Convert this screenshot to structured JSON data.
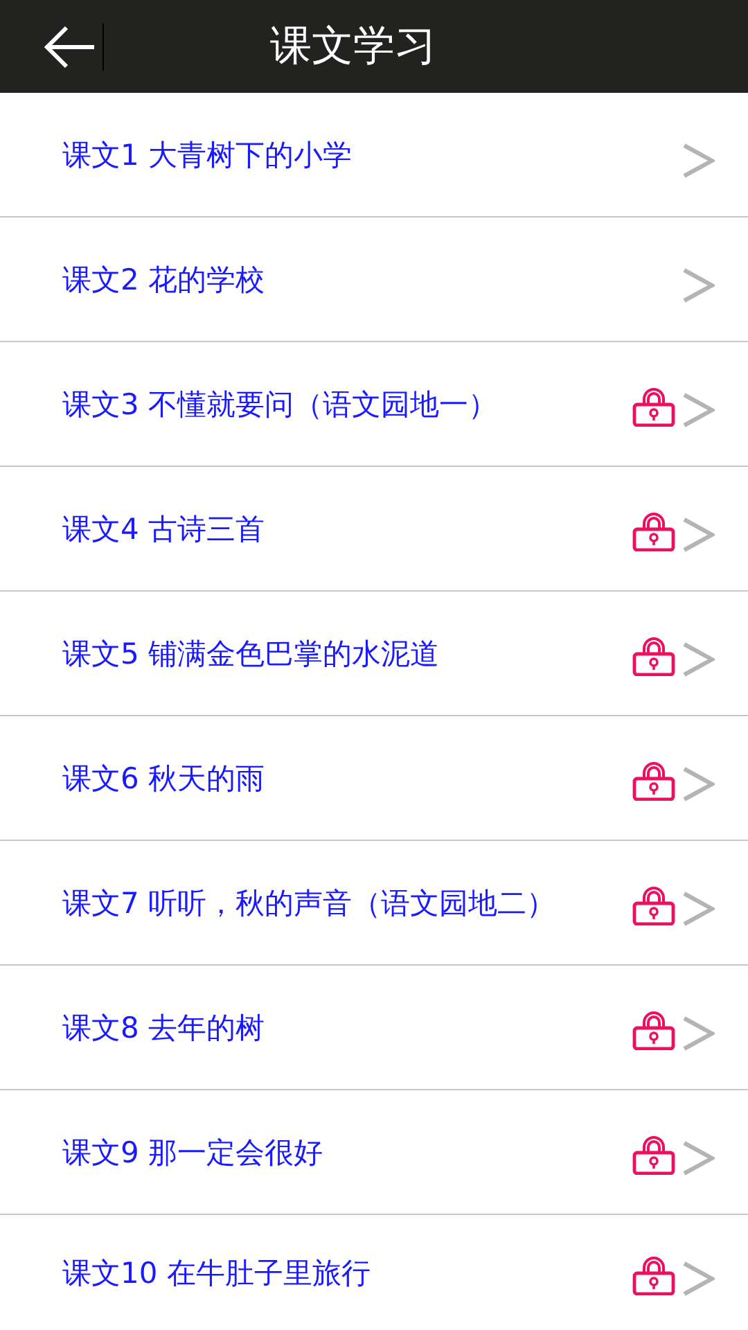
{
  "header": {
    "title": "课文学习"
  },
  "lessons": [
    {
      "title": "课文1 大青树下的小学",
      "locked": false
    },
    {
      "title": "课文2 花的学校",
      "locked": false
    },
    {
      "title": "课文3 不懂就要问（语文园地一）",
      "locked": true
    },
    {
      "title": "课文4 古诗三首",
      "locked": true
    },
    {
      "title": "课文5 铺满金色巴掌的水泥道",
      "locked": true
    },
    {
      "title": "课文6 秋天的雨",
      "locked": true
    },
    {
      "title": "课文7 听听，秋的声音（语文园地二）",
      "locked": true
    },
    {
      "title": "课文8 去年的树",
      "locked": true
    },
    {
      "title": "课文9 那一定会很好",
      "locked": true
    },
    {
      "title": "课文10 在牛肚子里旅行",
      "locked": true
    }
  ]
}
